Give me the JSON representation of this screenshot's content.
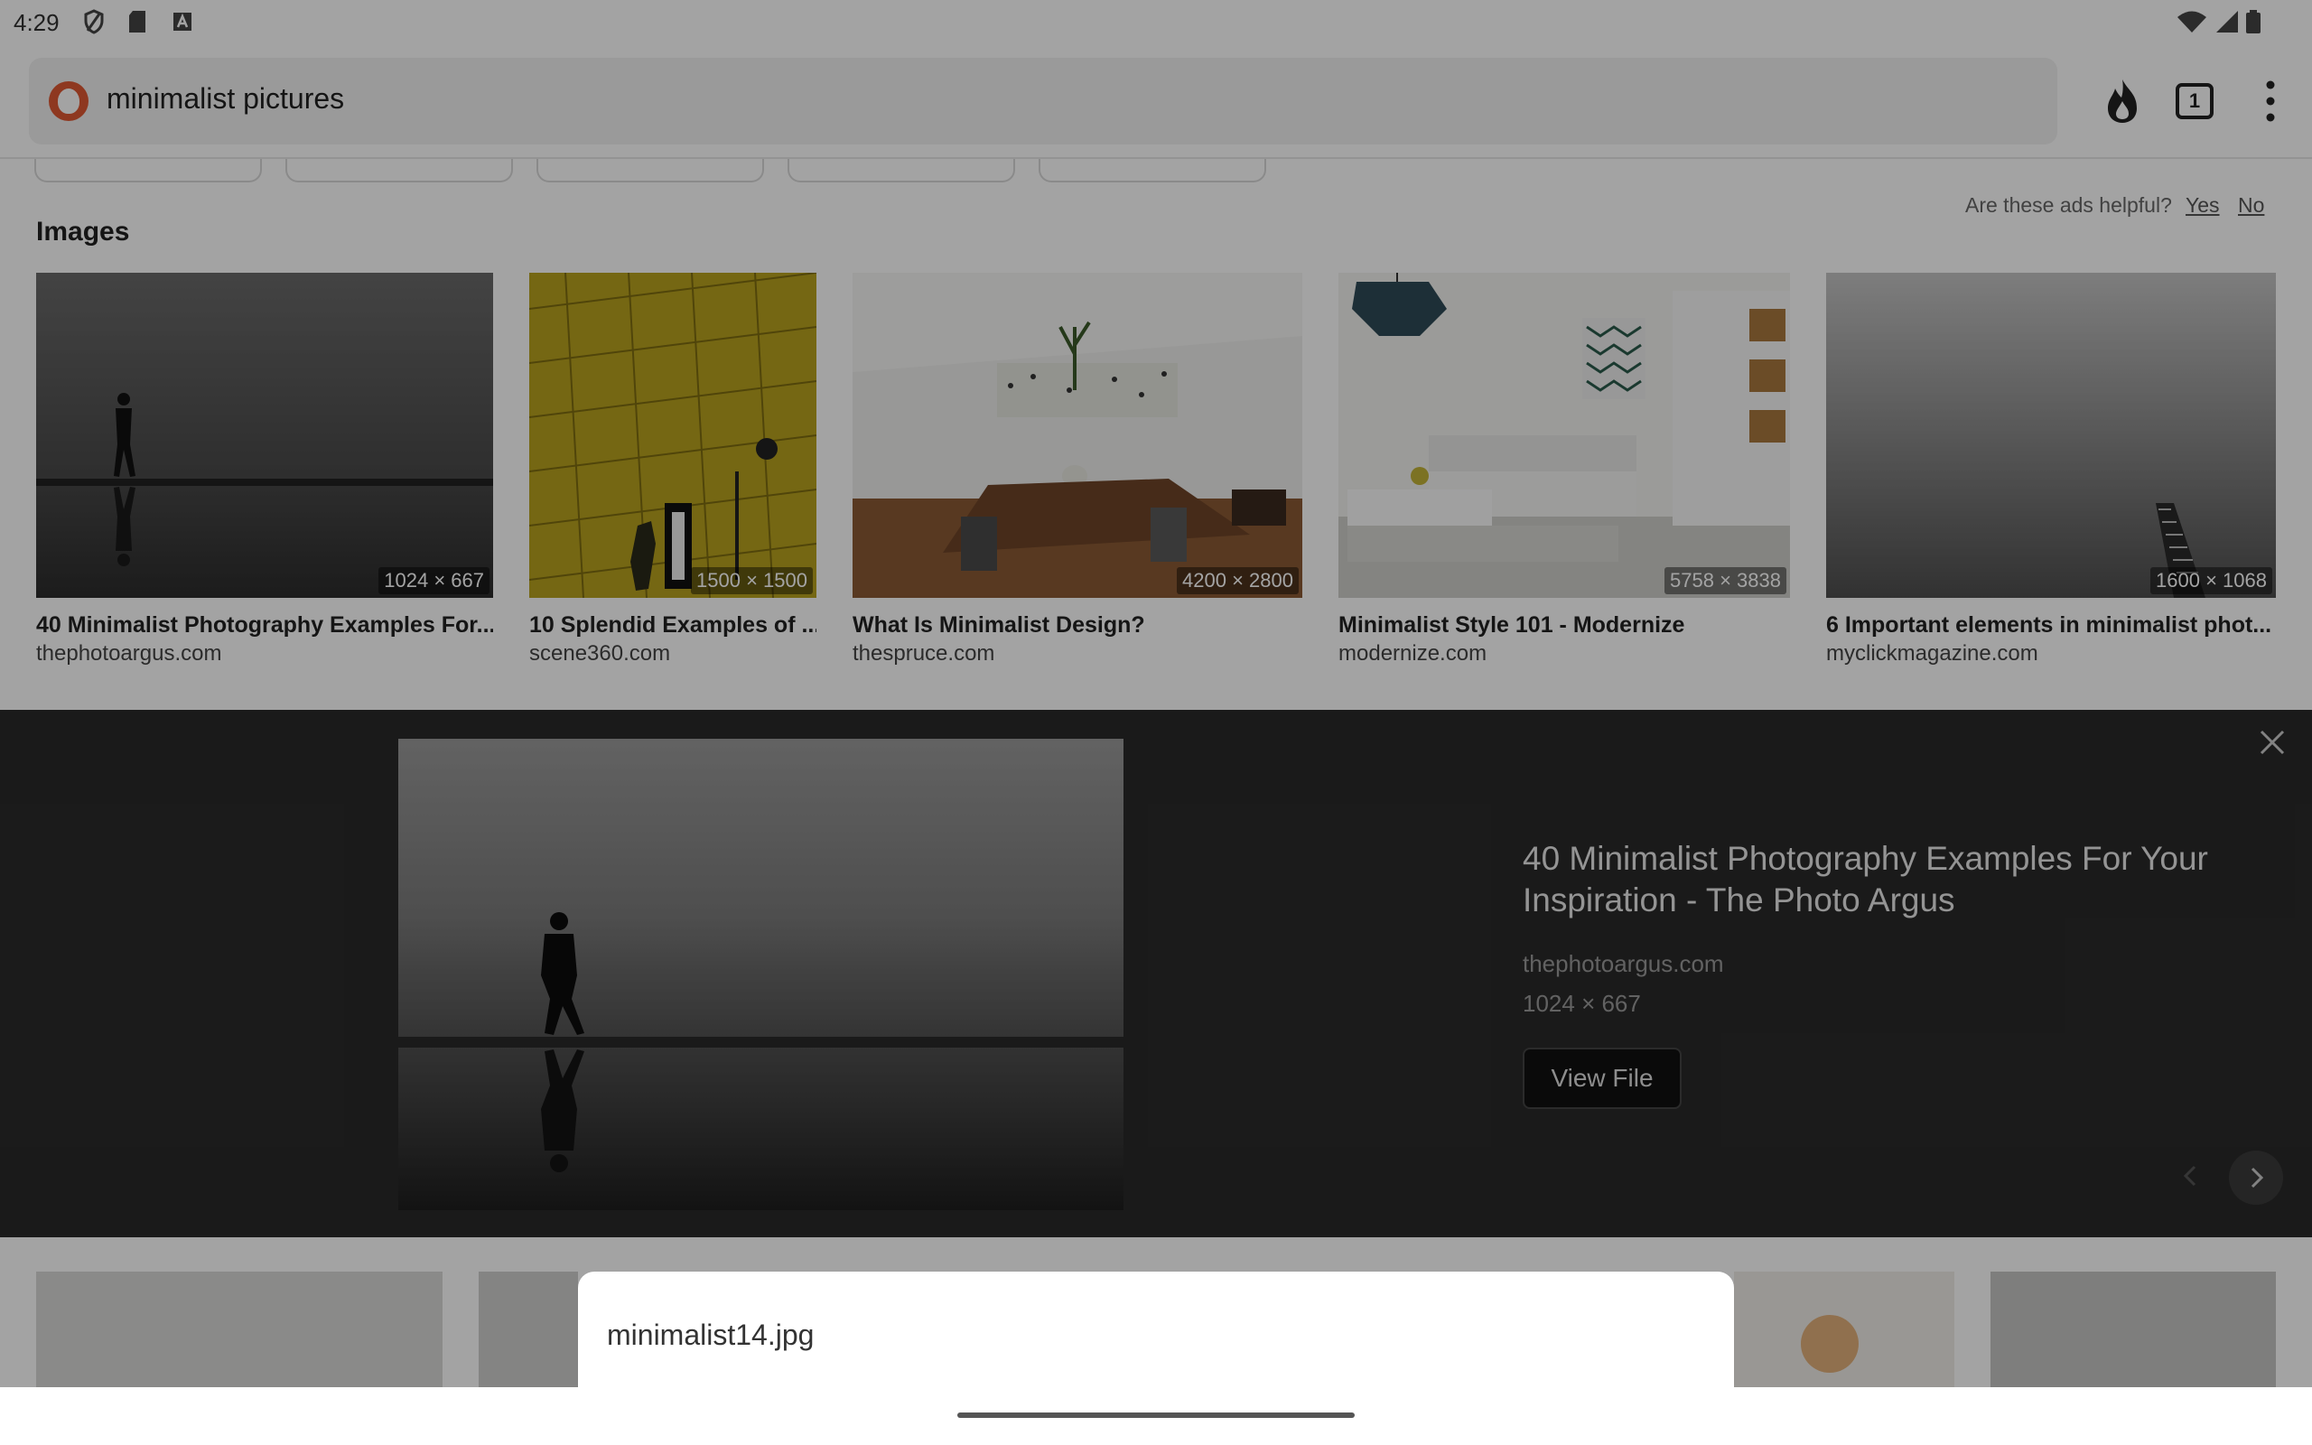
{
  "status_bar": {
    "time": "4:29"
  },
  "browser": {
    "address": "minimalist pictures",
    "tab_count": "1"
  },
  "ads_feedback": {
    "question": "Are these ads helpful?",
    "yes": "Yes",
    "no": "No"
  },
  "images_section": {
    "heading": "Images",
    "items": [
      {
        "title": "40 Minimalist Photography Examples For...",
        "source": "thephotoargus.com",
        "dims": "1024 × 667"
      },
      {
        "title": "10 Splendid Examples of ...",
        "source": "scene360.com",
        "dims": "1500 × 1500"
      },
      {
        "title": "What Is Minimalist Design?",
        "source": "thespruce.com",
        "dims": "4200 × 2800"
      },
      {
        "title": "Minimalist Style 101 - Modernize",
        "source": "modernize.com",
        "dims": "5758 × 3838"
      },
      {
        "title": "6 Important elements in minimalist phot...",
        "source": "myclickmagazine.com",
        "dims": "1600 × 1068"
      }
    ]
  },
  "preview": {
    "title": "40 Minimalist Photography Examples For Your Inspiration - The Photo Argus",
    "source": "thephotoargus.com",
    "dims": "1024 × 667",
    "view_button": "View File"
  },
  "download_sheet": {
    "filename": "minimalist14.jpg"
  }
}
